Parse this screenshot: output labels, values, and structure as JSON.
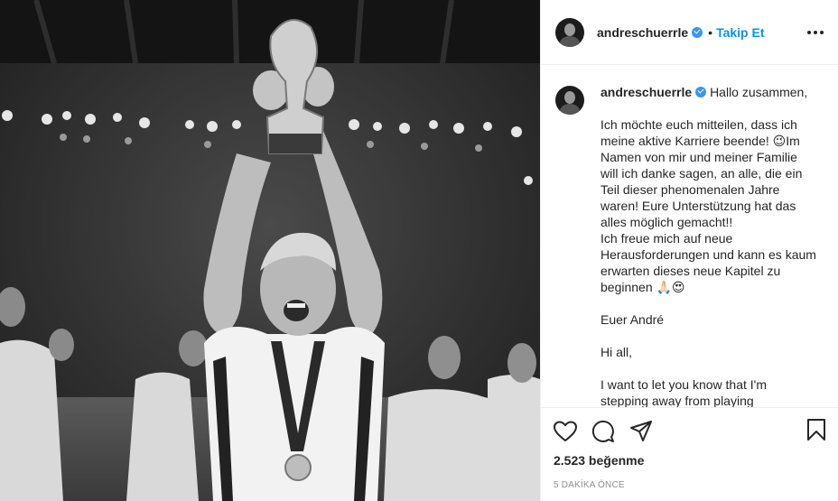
{
  "post": {
    "username": "andreschuerrle",
    "follow_label": "Takip Et",
    "separator": "•",
    "caption": "Hallo zusammen,\n\nIch möchte euch mitteilen, dass ich meine aktive Karriere beende! 😉Im Namen von mir und meiner Familie will ich danke sagen, an alle, die ein Teil dieser phenomenalen Jahre waren! Eure Unterstützung hat das alles möglich gemacht!!\nIch freue mich auf neue Herausforderungen und kann es kaum erwarten dieses neue Kapitel zu beginnen 🙏🏻😍\n\nEuer André\n\nHi all,\n\nI want to let you know that I'm stepping away from playing",
    "likes": "2.523 beğenme",
    "time": "5 DAKİKA ÖNCE"
  },
  "icons": {
    "like": "heart-icon",
    "comment": "comment-icon",
    "share": "share-icon",
    "save": "bookmark-icon",
    "more": "more-options-icon",
    "verified": "verified-badge-icon"
  },
  "colors": {
    "link": "#0095f6",
    "verified": "#3897f0",
    "text": "#262626",
    "muted": "#8e8e8e"
  }
}
